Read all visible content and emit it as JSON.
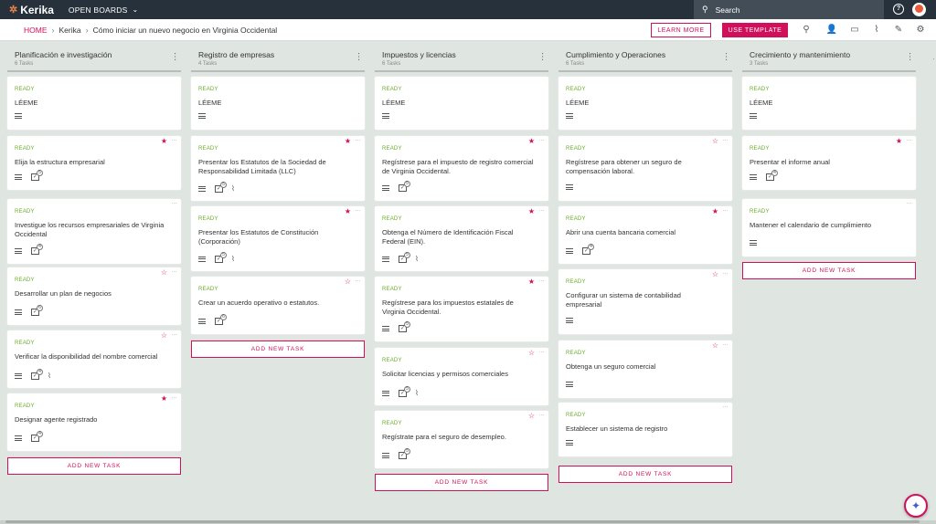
{
  "topbar": {
    "logo": "Kerika",
    "open_boards": "OPEN BOARDS",
    "search_placeholder": "Search",
    "help": "?"
  },
  "breadcrumb": {
    "home": "HOME",
    "items": [
      "Kerika",
      "Cómo iniciar un nuevo negocio en Virginia Occidental"
    ]
  },
  "actions": {
    "learn_more": "LEARN MORE",
    "use_template": "USE TEMPLATE"
  },
  "colors": {
    "accent": "#d0105a",
    "ready": "#6bad2a",
    "topbar": "#27313b",
    "background": "#dfe5e1"
  },
  "add_task_label": "ADD NEW TASK",
  "columns": [
    {
      "title": "Planificación e investigación",
      "count": "6 Tasks",
      "cards": [
        {
          "status": "READY",
          "title": "LÉEME",
          "star": "none",
          "checklist": "",
          "attach": false
        },
        {
          "status": "READY",
          "title": "Elija la estructura empresarial",
          "star": "filled",
          "checklist": "5",
          "attach": false
        },
        {
          "status": "READY",
          "title": "Investigue los recursos empresariales de Virginia Occidental",
          "star": "none",
          "checklist": "4",
          "attach": false
        },
        {
          "status": "READY",
          "title": "Desarrollar un plan de negocios",
          "star": "outline",
          "checklist": "6",
          "attach": false
        },
        {
          "status": "READY",
          "title": "Verificar la disponibilidad del nombre comercial",
          "star": "outline",
          "checklist": "4",
          "attach": true
        },
        {
          "status": "READY",
          "title": "Designar agente registrado",
          "star": "filled",
          "checklist": "4",
          "attach": false
        }
      ]
    },
    {
      "title": "Registro de empresas",
      "count": "4 Tasks",
      "cards": [
        {
          "status": "READY",
          "title": "LÉEME",
          "star": "none",
          "checklist": "",
          "attach": false
        },
        {
          "status": "READY",
          "title": "Presentar los Estatutos de la Sociedad de Responsabilidad Limitada (LLC)",
          "star": "filled",
          "checklist": "5",
          "attach": true
        },
        {
          "status": "READY",
          "title": "Presentar los Estatutos de Constitución (Corporación)",
          "star": "filled",
          "checklist": "5",
          "attach": true
        },
        {
          "status": "READY",
          "title": "Crear un acuerdo operativo o estatutos.",
          "star": "outline",
          "checklist": "6",
          "attach": false
        }
      ]
    },
    {
      "title": "Impuestos y licencias",
      "count": "6 Tasks",
      "cards": [
        {
          "status": "READY",
          "title": "LÉEME",
          "star": "none",
          "checklist": "",
          "attach": false
        },
        {
          "status": "READY",
          "title": "Regístrese para el impuesto de registro comercial de Virginia Occidental.",
          "star": "filled",
          "checklist": "5",
          "attach": false
        },
        {
          "status": "READY",
          "title": "Obtenga el Número de Identificación Fiscal Federal (EIN).",
          "star": "filled",
          "checklist": "5",
          "attach": true
        },
        {
          "status": "READY",
          "title": "Regístrese para los impuestos estatales de Virginia Occidental.",
          "star": "filled",
          "checklist": "5",
          "attach": false
        },
        {
          "status": "READY",
          "title": "Solicitar licencias y permisos comerciales",
          "star": "outline",
          "checklist": "5",
          "attach": true
        },
        {
          "status": "READY",
          "title": "Regístrate para el seguro de desempleo.",
          "star": "outline",
          "checklist": "5",
          "attach": false
        }
      ]
    },
    {
      "title": "Cumplimiento y Operaciones",
      "count": "6 Tasks",
      "cards": [
        {
          "status": "READY",
          "title": "LÉEME",
          "star": "none",
          "checklist": "",
          "attach": false
        },
        {
          "status": "READY",
          "title": "Regístrese para obtener un seguro de compensación laboral.",
          "star": "outline",
          "checklist": "",
          "attach": false
        },
        {
          "status": "READY",
          "title": "Abrir una cuenta bancaria comercial",
          "star": "filled",
          "checklist": "4",
          "attach": false
        },
        {
          "status": "READY",
          "title": "Configurar un sistema de contabilidad empresarial",
          "star": "outline",
          "checklist": "",
          "attach": false
        },
        {
          "status": "READY",
          "title": "Obtenga un seguro comercial",
          "star": "outline",
          "checklist": "",
          "attach": false
        },
        {
          "status": "READY",
          "title": "Establecer un sistema de registro",
          "star": "none",
          "checklist": "",
          "attach": false
        }
      ]
    },
    {
      "title": "Crecimiento y mantenimiento",
      "count": "3 Tasks",
      "cards": [
        {
          "status": "READY",
          "title": "LÉEME",
          "star": "none",
          "checklist": "",
          "attach": false
        },
        {
          "status": "READY",
          "title": "Presentar el informe anual",
          "star": "filled",
          "checklist": "4",
          "attach": false
        },
        {
          "status": "READY",
          "title": "Mantener el calendario de cumplimiento",
          "star": "none",
          "checklist": "",
          "attach": false
        }
      ]
    }
  ]
}
